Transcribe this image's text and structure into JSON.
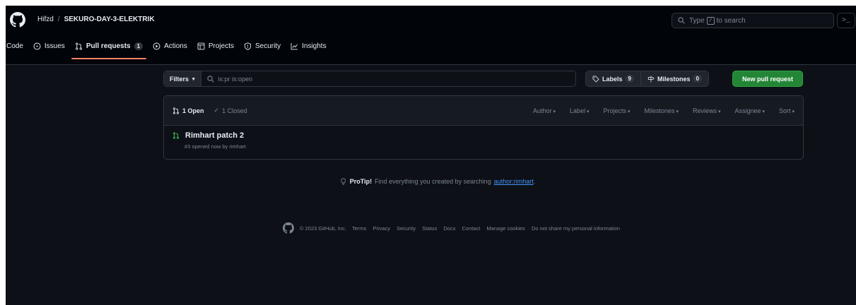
{
  "header": {
    "owner": "Hifzd",
    "separator": "/",
    "repo": "SEKURO-DAY-3-ELEKTRIK",
    "search_prefix": "Type",
    "search_key": "/",
    "search_suffix": "to search",
    "command_palette": ">_"
  },
  "nav": {
    "tabs": [
      {
        "label": "Code",
        "icon": "code-icon"
      },
      {
        "label": "Issues",
        "icon": "issue-icon"
      },
      {
        "label": "Pull requests",
        "icon": "pull-request-icon",
        "count": "1",
        "active": true
      },
      {
        "label": "Actions",
        "icon": "play-icon"
      },
      {
        "label": "Projects",
        "icon": "table-icon"
      },
      {
        "label": "Security",
        "icon": "shield-icon"
      },
      {
        "label": "Insights",
        "icon": "graph-icon"
      }
    ]
  },
  "toolbar": {
    "filters_label": "Filters",
    "search_value": "is:pr is:open",
    "labels_label": "Labels",
    "labels_count": "9",
    "milestones_label": "Milestones",
    "milestones_count": "0",
    "new_pr_label": "New pull request"
  },
  "list": {
    "open_label": "1 Open",
    "closed_label": "1 Closed",
    "menus": [
      "Author",
      "Label",
      "Projects",
      "Milestones",
      "Reviews",
      "Assignee",
      "Sort"
    ],
    "items": [
      {
        "title": "Rimhart patch 2",
        "meta": "#3 opened now by rimhart"
      }
    ]
  },
  "protip": {
    "title": "ProTip!",
    "text": "Find everything you created by searching",
    "link": "author:rimhart",
    "end": "."
  },
  "footer": {
    "copyright": "© 2023 GitHub, Inc.",
    "links": [
      "Terms",
      "Privacy",
      "Security",
      "Status",
      "Docs",
      "Contact",
      "Manage cookies",
      "Do not share my personal information"
    ]
  },
  "colors": {
    "background": "#0d1117",
    "header_bg": "#010409",
    "accent_underline": "#f78166",
    "open_green": "#3fb950",
    "primary_button": "#238636",
    "link": "#4493f8"
  }
}
